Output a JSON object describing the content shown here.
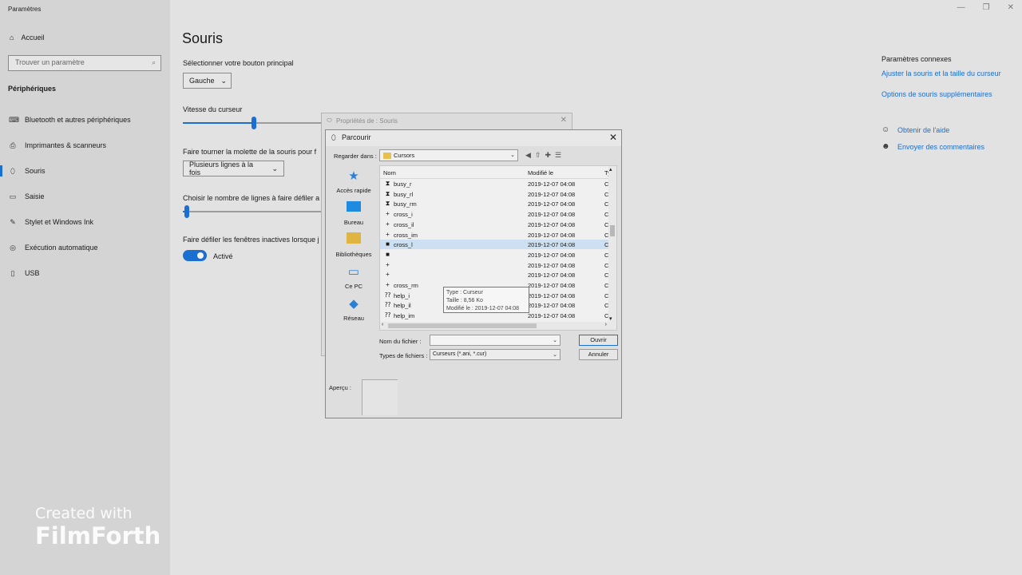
{
  "settings": {
    "app_title": "Paramètres",
    "home_label": "Accueil",
    "search_placeholder": "Trouver un paramètre",
    "section_title": "Périphériques",
    "nav_items": [
      {
        "label": "Bluetooth et autres périphériques",
        "icon": "bluetooth-icon"
      },
      {
        "label": "Imprimantes & scanneurs",
        "icon": "printer-icon"
      },
      {
        "label": "Souris",
        "icon": "mouse-icon",
        "active": true
      },
      {
        "label": "Saisie",
        "icon": "keyboard-icon"
      },
      {
        "label": "Stylet et Windows Ink",
        "icon": "pen-icon"
      },
      {
        "label": "Exécution automatique",
        "icon": "autoplay-icon"
      },
      {
        "label": "USB",
        "icon": "usb-icon"
      }
    ],
    "watermark": {
      "line1": "Created with",
      "line2": "FilmForth"
    }
  },
  "page": {
    "title": "Souris",
    "primary_button_label": "Sélectionner votre bouton principal",
    "primary_button_value": "Gauche",
    "cursor_speed_label": "Vitesse du curseur",
    "cursor_speed_level": 0.51,
    "wheel_label": "Faire tourner la molette de la souris pour f",
    "wheel_value": "Plusieurs lignes à la fois",
    "lines_label": "Choisir le nombre de lignes à faire défiler a",
    "lines_level": 0.03,
    "inactive_scroll_label": "Faire défiler les fenêtres inactives lorsque j",
    "inactive_scroll_state": "Activé",
    "related_title": "Paramètres connexes",
    "related_links": [
      "Ajuster la souris et la taille du curseur",
      "Options de souris supplémentaires"
    ],
    "help_links": [
      {
        "label": "Obtenir de l'aide",
        "icon": "help-icon"
      },
      {
        "label": "Envoyer des commentaires",
        "icon": "feedback-icon"
      }
    ]
  },
  "props_dialog": {
    "title": "Propriétés de : Souris"
  },
  "browse_dialog": {
    "title": "Parcourir",
    "look_in_label": "Regarder dans :",
    "look_in_value": "Cursors",
    "places": [
      "Accès rapide",
      "Bureau",
      "Bibliothèques",
      "Ce PC",
      "Réseau"
    ],
    "columns": {
      "name": "Nom",
      "modified": "Modifié le",
      "type": "Ty"
    },
    "files": [
      {
        "name": "busy_r",
        "date": "2019-12-07 04:08",
        "type": "Cu",
        "icon": "hourglass"
      },
      {
        "name": "busy_rl",
        "date": "2019-12-07 04:08",
        "type": "Cu",
        "icon": "hourglass"
      },
      {
        "name": "busy_rm",
        "date": "2019-12-07 04:08",
        "type": "Cu",
        "icon": "hourglass"
      },
      {
        "name": "cross_i",
        "date": "2019-12-07 04:08",
        "type": "Cu",
        "icon": "cross"
      },
      {
        "name": "cross_il",
        "date": "2019-12-07 04:08",
        "type": "Cu",
        "icon": "cross"
      },
      {
        "name": "cross_im",
        "date": "2019-12-07 04:08",
        "type": "Cu",
        "icon": "cross"
      },
      {
        "name": "cross_l",
        "date": "2019-12-07 04:08",
        "type": "Cu",
        "icon": "block",
        "selected": true
      },
      {
        "name": "",
        "date": "2019-12-07 04:08",
        "type": "Cu",
        "icon": "block"
      },
      {
        "name": "",
        "date": "2019-12-07 04:08",
        "type": "Cu",
        "icon": "cross"
      },
      {
        "name": "",
        "date": "2019-12-07 04:08",
        "type": "Cu",
        "icon": "cross"
      },
      {
        "name": "cross_rm",
        "date": "2019-12-07 04:08",
        "type": "Cu",
        "icon": "cross"
      },
      {
        "name": "help_i",
        "date": "2019-12-07 04:08",
        "type": "Cu",
        "icon": "help"
      },
      {
        "name": "help_il",
        "date": "2019-12-07 04:08",
        "type": "Cu",
        "icon": "help"
      },
      {
        "name": "help_im",
        "date": "2019-12-07 04:08",
        "type": "Cu",
        "icon": "help"
      }
    ],
    "tooltip": {
      "type": "Type : Curseur",
      "size": "Taille : 8,56 Ko",
      "modified": "Modifié le : 2019-12-07 04:08"
    },
    "filename_label": "Nom du fichier :",
    "filename_value": "",
    "filetype_label": "Types de fichiers :",
    "filetype_value": "Curseurs (*.ani, *.cur)",
    "open_button": "Ouvrir",
    "cancel_button": "Annuler",
    "preview_label": "Aperçu :"
  }
}
